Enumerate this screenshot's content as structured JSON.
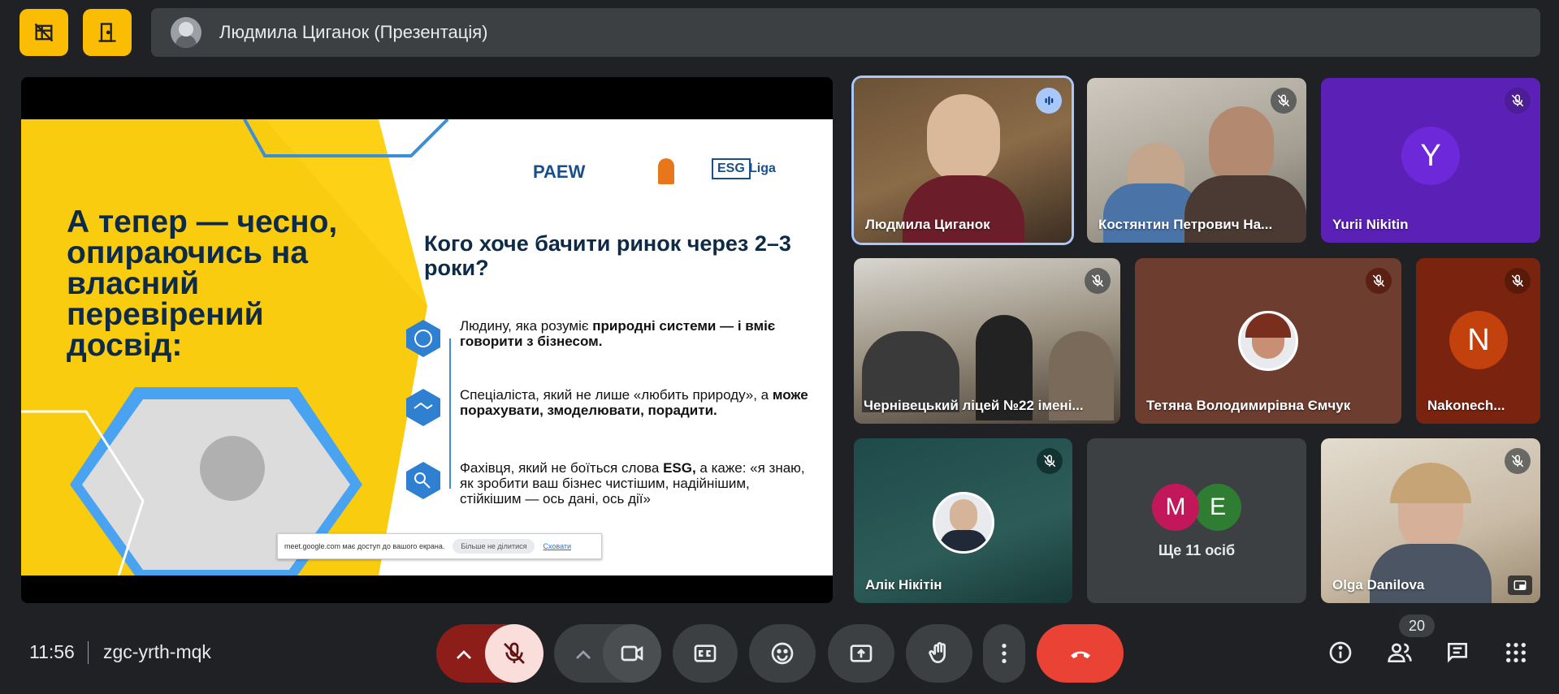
{
  "presenter": {
    "name": "Людмила Циганок (Презентація)"
  },
  "slide": {
    "title": "А тепер — чесно, опираючись на власний перевірений досвід:",
    "question": "Кого хоче бачити ринок через 2–3 роки?",
    "items": [
      {
        "text_before": "Людину, яка розуміє ",
        "bold": "природні системи — і вміє говорити з бізнесом.",
        "text_after": ""
      },
      {
        "text_before": "Спеціаліста, який не лише «любить природу», а ",
        "bold": "може порахувати, змоделювати, порадити.",
        "text_after": ""
      },
      {
        "text_before": "Фахівця, який не боїться слова ",
        "bold": "ESG,",
        "text_after": " а каже: «я знаю, як зробити ваш бізнес чистішим, надійнішим, стійкішим — ось дані, ось дії»"
      }
    ],
    "logos": {
      "paew": "PAEW",
      "esg": "ESG",
      "liga": "Liga"
    },
    "share_notice": {
      "text": "meet.google.com має доступ до вашого екрана.",
      "stop": "Більше не ділитися",
      "hide": "Сховати"
    }
  },
  "participants": [
    {
      "name": "Людмила Циганок"
    },
    {
      "name": "Костянтин Петрович На..."
    },
    {
      "name": "Yurii Nikitin",
      "initial": "Y"
    },
    {
      "name": "Чернівецький ліцей №22 імені..."
    },
    {
      "name": "Тетяна Володимирівна Ємчук"
    },
    {
      "name": "Nakonech...",
      "initial": "N"
    },
    {
      "name": "Алік Нікітін"
    },
    {
      "name": "Ще 11 осіб",
      "initials": [
        "M",
        "E"
      ]
    },
    {
      "name": "Olga Danilova"
    }
  ],
  "bottom": {
    "time": "11:56",
    "meeting_code": "zgc-yrth-mqk",
    "participant_count": "20"
  },
  "colors": {
    "yellow": "#fbbc04",
    "end_call": "#ea4335",
    "mic_off_bg": "#f9dedc",
    "purple_tile": "#5b21b6",
    "orange_avatar": "#c2410c"
  }
}
